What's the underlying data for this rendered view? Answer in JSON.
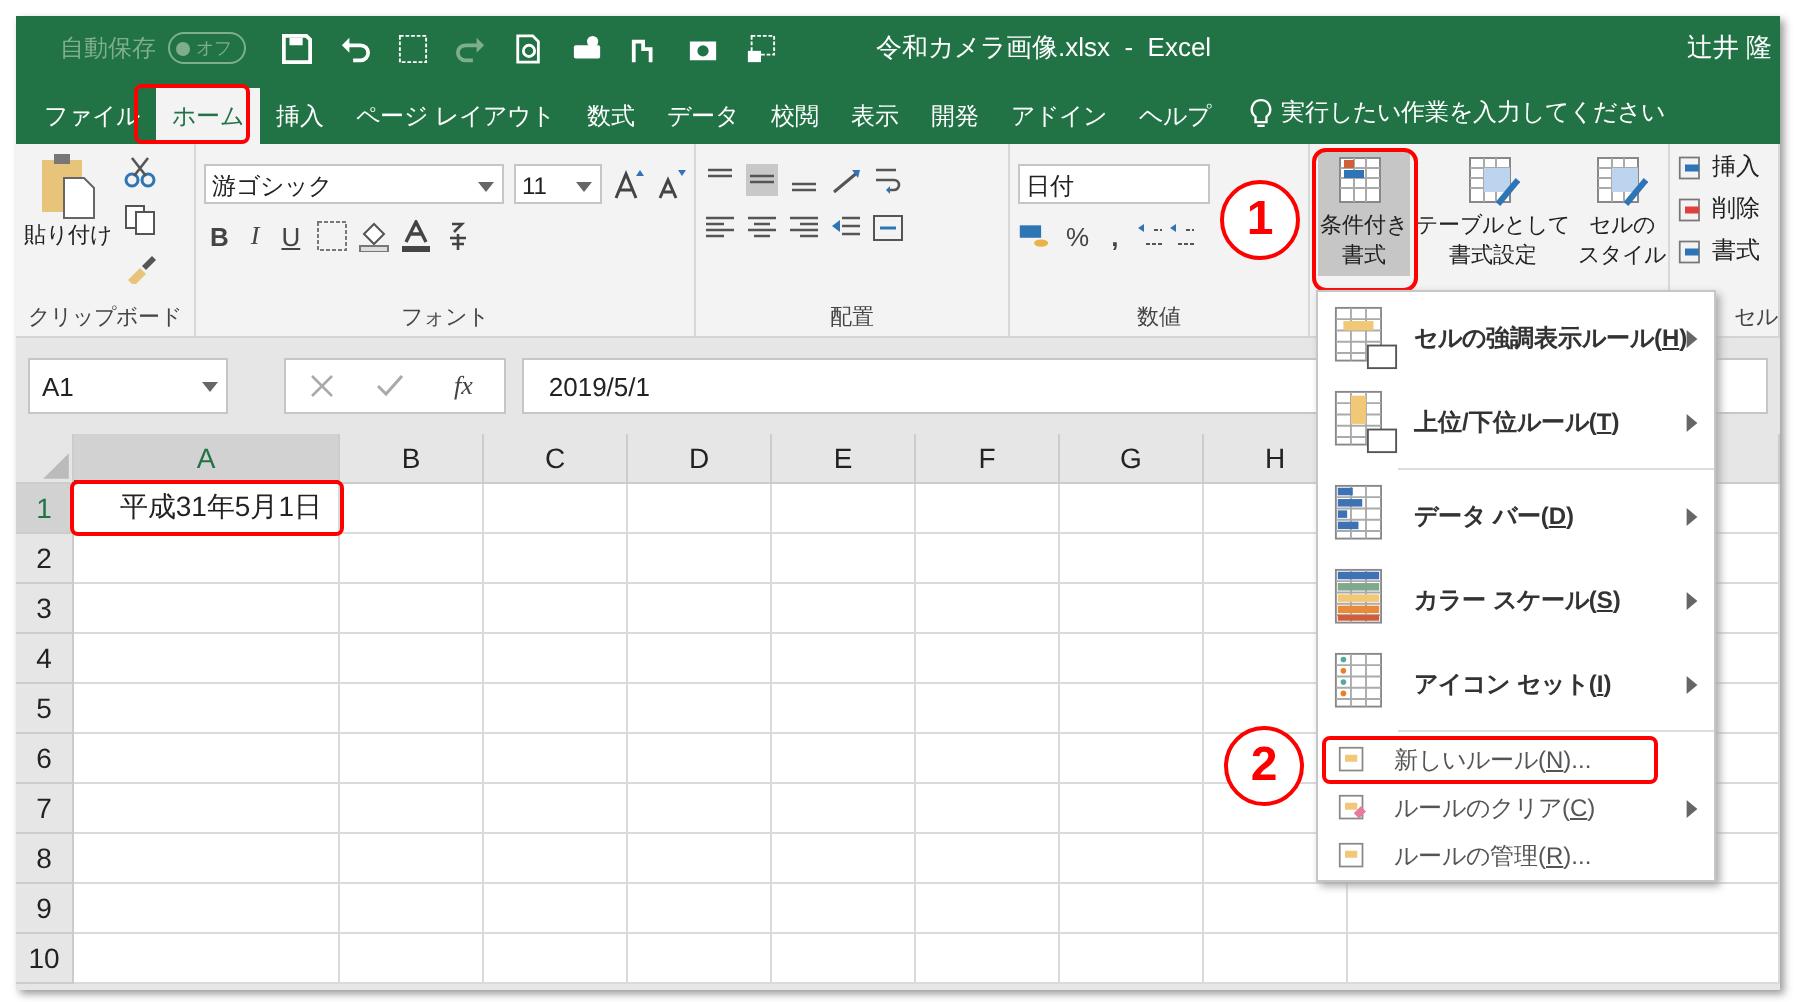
{
  "title_bar": {
    "autosave_label": "自動保存",
    "autosave_state": "オフ",
    "autosave_on": false,
    "title": "令和カメラ画像.xlsx  -  Excel",
    "user": "辻井 隆"
  },
  "tabs": [
    {
      "label": "ファイル",
      "selected": false
    },
    {
      "label": "ホーム",
      "selected": true
    },
    {
      "label": "挿入",
      "selected": false
    },
    {
      "label": "ページ レイアウト",
      "selected": false
    },
    {
      "label": "数式",
      "selected": false
    },
    {
      "label": "データ",
      "selected": false
    },
    {
      "label": "校閲",
      "selected": false
    },
    {
      "label": "表示",
      "selected": false
    },
    {
      "label": "開発",
      "selected": false
    },
    {
      "label": "アドイン",
      "selected": false
    },
    {
      "label": "ヘルプ",
      "selected": false
    }
  ],
  "tell_me": {
    "placeholder": "実行したい作業を入力してください"
  },
  "ribbon": {
    "clipboard": {
      "paste": "貼り付け",
      "label": "クリップボード"
    },
    "font": {
      "font_name": "游ゴシック",
      "font_size": "11",
      "bold": "B",
      "italic": "I",
      "underline": "U",
      "label": "フォント"
    },
    "alignment": {
      "label": "配置"
    },
    "number": {
      "format": "日付",
      "percent": "%",
      "comma": ",",
      "label": "数値"
    },
    "styles": {
      "buttons": [
        {
          "lines": [
            "条件付き",
            "書式"
          ],
          "selected": true
        },
        {
          "lines": [
            "テーブルとして",
            "書式設定"
          ],
          "selected": false
        },
        {
          "lines": [
            "セルの",
            "スタイル"
          ],
          "selected": false
        }
      ]
    },
    "cells": {
      "buttons": [
        "挿入",
        "削除",
        "書式"
      ],
      "label": "セル"
    }
  },
  "formula_bar": {
    "name_box": "A1",
    "fx": "fx",
    "formula": "2019/5/1"
  },
  "sheet": {
    "columns": [
      {
        "label": "A",
        "selected": true
      },
      {
        "label": "B",
        "selected": false
      },
      {
        "label": "C",
        "selected": false
      },
      {
        "label": "D",
        "selected": false
      },
      {
        "label": "E",
        "selected": false
      },
      {
        "label": "F",
        "selected": false
      },
      {
        "label": "G",
        "selected": false
      },
      {
        "label": "H",
        "selected": false
      }
    ],
    "rows": [
      {
        "label": "1",
        "selected": true,
        "cells": [
          "平成31年5月1日"
        ]
      },
      {
        "label": "2",
        "selected": false,
        "cells": []
      },
      {
        "label": "3",
        "selected": false,
        "cells": []
      },
      {
        "label": "4",
        "selected": false,
        "cells": []
      },
      {
        "label": "5",
        "selected": false,
        "cells": []
      },
      {
        "label": "6",
        "selected": false,
        "cells": []
      },
      {
        "label": "7",
        "selected": false,
        "cells": []
      },
      {
        "label": "8",
        "selected": false,
        "cells": []
      },
      {
        "label": "9",
        "selected": false,
        "cells": []
      },
      {
        "label": "10",
        "selected": false,
        "cells": []
      }
    ]
  },
  "menu": {
    "items": [
      {
        "kind": "large",
        "text": "セルの強調表示ルール(",
        "key": "H",
        "end": ")",
        "submenu": true,
        "separator_after": false
      },
      {
        "kind": "large",
        "text": "上位/下位ルール(",
        "key": "T",
        "end": ")",
        "submenu": true,
        "separator_after": true
      },
      {
        "kind": "large",
        "text": "データ バー(",
        "key": "D",
        "end": ")",
        "submenu": true,
        "separator_after": false
      },
      {
        "kind": "large",
        "text": "カラー スケール(",
        "key": "S",
        "end": ")",
        "submenu": true,
        "separator_after": false
      },
      {
        "kind": "large",
        "text": "アイコン セット(",
        "key": "I",
        "end": ")",
        "submenu": true,
        "separator_after": true
      },
      {
        "kind": "small",
        "text": "新しいルール(",
        "key": "N",
        "end": ")...",
        "submenu": false,
        "separator_after": false,
        "framed": true
      },
      {
        "kind": "small",
        "text": "ルールのクリア(",
        "key": "C",
        "end": ")",
        "submenu": true,
        "separator_after": false
      },
      {
        "kind": "small",
        "text": "ルールの管理(",
        "key": "R",
        "end": ")...",
        "submenu": false,
        "separator_after": false
      }
    ]
  },
  "annotations": [
    {
      "number": "1"
    },
    {
      "number": "2"
    }
  ]
}
